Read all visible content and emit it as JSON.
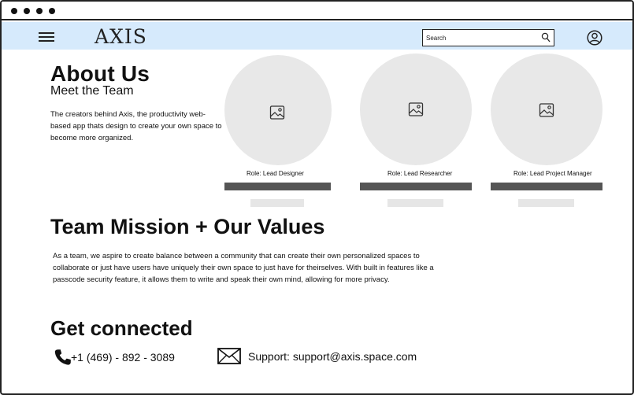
{
  "window": {
    "controls": [
      "dot",
      "dot",
      "dot",
      "dot"
    ]
  },
  "navbar": {
    "menu_icon": "hamburger-icon",
    "logo": "AXIS",
    "search_placeholder": "Search",
    "search_icon": "search-icon",
    "account_icon": "user-circle-icon",
    "background": "#d6eafc"
  },
  "about": {
    "title": "About Us",
    "subtitle": "Meet the Team",
    "description": "The creators behind Axis, the productivity web-based app thats design to create your own space to become more organized."
  },
  "team": [
    {
      "role": "Role:  Lead Designer",
      "image_icon": "image-placeholder-icon"
    },
    {
      "role": "Role:  Lead Researcher",
      "image_icon": "image-placeholder-icon"
    },
    {
      "role": "Role:  Lead Project Manager",
      "image_icon": "image-placeholder-icon"
    }
  ],
  "mission": {
    "title": "Team Mission + Our Values",
    "text": "As a team, we aspire to create balance between a community that can create their own personalized spaces to collaborate or just have users have uniquely their own space to just have for theirselves. With built in features like a passcode security feature, it allows them to write and speak their own mind, allowing for more privacy."
  },
  "contact": {
    "title": "Get connected",
    "phone": "+1 (469) - 892 - 3089",
    "phone_icon": "phone-icon",
    "support": "Support:  support@axis.space.com",
    "mail_icon": "mail-icon"
  }
}
